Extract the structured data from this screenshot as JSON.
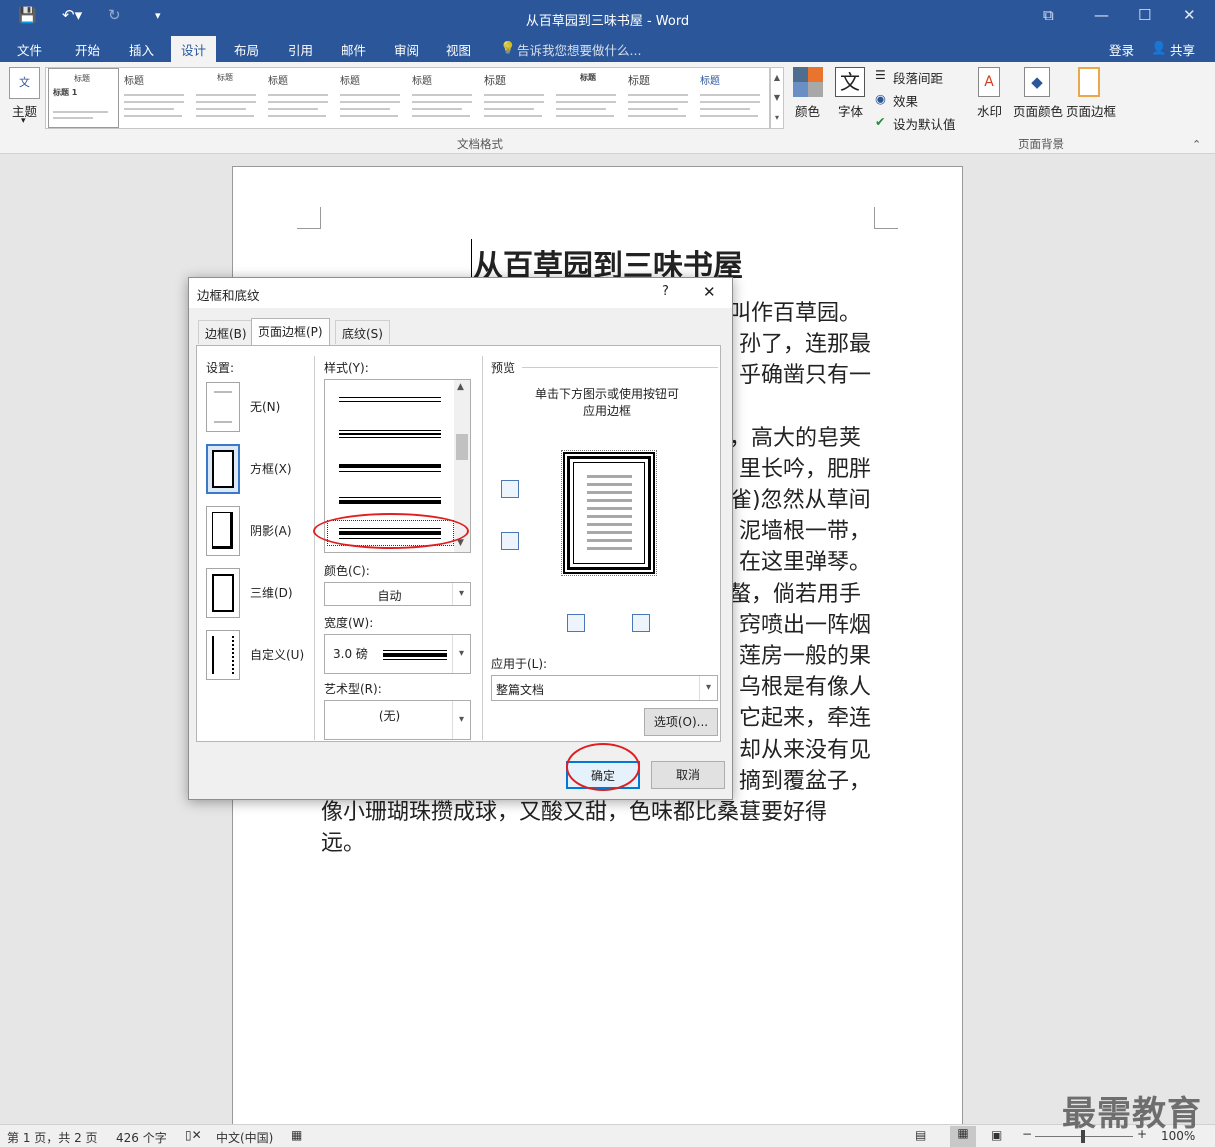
{
  "window": {
    "title": "从百草园到三味书屋 - Word"
  },
  "tabs": {
    "file": "文件",
    "home": "开始",
    "insert": "插入",
    "design": "设计",
    "layout": "布局",
    "references": "引用",
    "mailings": "邮件",
    "review": "审阅",
    "view": "视图",
    "tellme": "告诉我您想要做什么..."
  },
  "account": {
    "login": "登录",
    "share": "共享"
  },
  "ribbon": {
    "theme": "主题",
    "gallery": [
      {
        "t": "标题"
      },
      {
        "t": "标题"
      },
      {
        "t": "标题"
      },
      {
        "t": "标题"
      },
      {
        "t": "标题"
      },
      {
        "t": "标题"
      },
      {
        "t": "标题"
      },
      {
        "t": "标题"
      },
      {
        "t": "标题"
      },
      {
        "t": "标题"
      }
    ],
    "gallery_first_label": "标题 1",
    "colors": "颜色",
    "fonts": "字体",
    "para_spacing": "段落间距",
    "effects": "效果",
    "set_default": "设为默认值",
    "group_docformat": "文档格式",
    "watermark": "水印",
    "page_color": "页面颜色",
    "page_borders": "页面边框",
    "group_pagebg": "页面背景"
  },
  "document": {
    "title": "从百草园到三味书屋",
    "lines": [
      "叫作百草园。",
      "孙了，连那最",
      "乎确凿只有一",
      "，高大的皂荚",
      "里长吟，肥胖",
      "雀)忽然从草间",
      "泥墙根一带，",
      "在这里弹琴。",
      "螯，倘若用手",
      "窍喷出一阵烟",
      "莲房一般的果",
      "乌根是有像人",
      "它起来，牵连",
      "却从来没有见",
      "摘到覆盆子，"
    ],
    "full_lines": [
      "像小珊瑚珠攒成球，又酸又甜，色味都比桑葚要好得",
      "远。"
    ]
  },
  "dialog": {
    "title": "边框和底纹",
    "help": "?",
    "close": "✕",
    "tabs": [
      "边框(B)",
      "页面边框(P)",
      "底纹(S)"
    ],
    "settings_label": "设置:",
    "settings": [
      "无(N)",
      "方框(X)",
      "阴影(A)",
      "三维(D)",
      "自定义(U)"
    ],
    "style_label": "样式(Y):",
    "color_label": "颜色(C):",
    "color_value": "自动",
    "width_label": "宽度(W):",
    "width_value": "3.0 磅",
    "art_label": "艺术型(R):",
    "art_value": "(无)",
    "preview_label": "预览",
    "preview_hint1": "单击下方图示或使用按钮可",
    "preview_hint2": "应用边框",
    "apply_label": "应用于(L):",
    "apply_value": "整篇文档",
    "options": "选项(O)...",
    "ok": "确定",
    "cancel": "取消"
  },
  "status": {
    "page": "第 1 页，共 2 页",
    "words": "426 个字",
    "lang": "中文(中国)",
    "zoom": "100%"
  },
  "watermark": "最需教育"
}
